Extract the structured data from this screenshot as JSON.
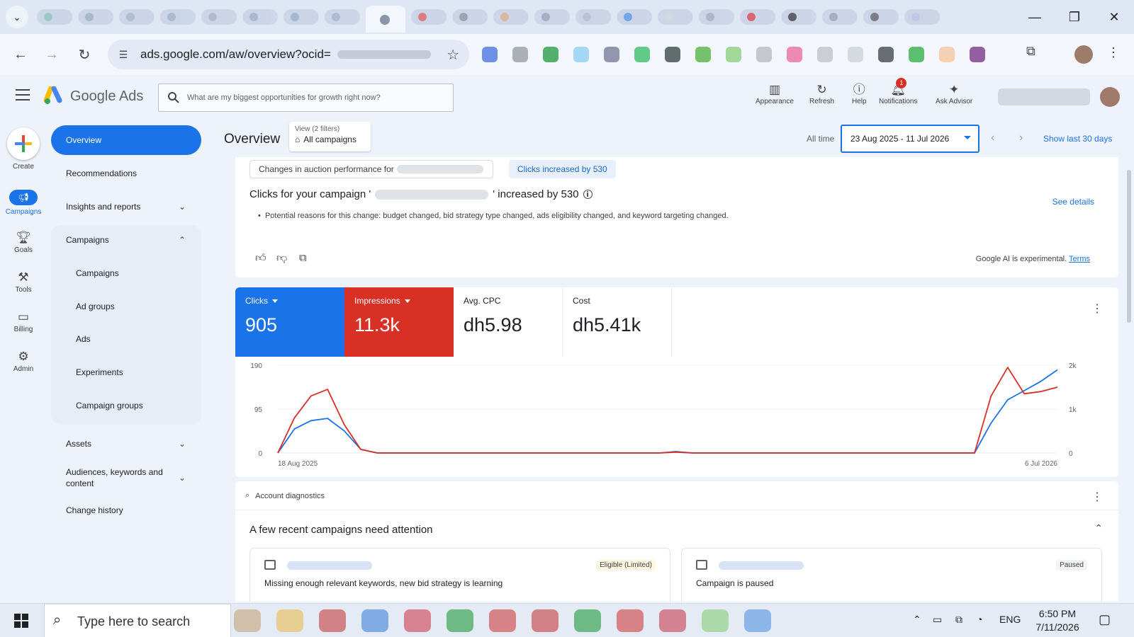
{
  "browser": {
    "url": "ads.google.com/aw/overview?ocid=",
    "tab_colors": [
      "#8fc4c0",
      "#9fb0c8",
      "#a8b6d0",
      "#a2b2cc",
      "#a6b4cd",
      "#a0b0ca",
      "#9cb0cc",
      "#a4b4ce"
    ],
    "tab_colors_right": [
      "#d96b6b",
      "#9099a8",
      "#d9b08c",
      "#9aa6bf",
      "#b3bfd3",
      "#5e9be0",
      "#d0d6e0",
      "#a3b0c8",
      "#d9515e",
      "#4a4a52",
      "#9aa6bf",
      "#6b6b75",
      "#b9c4e6"
    ],
    "extension_colors": [
      "#4a78e0",
      "#9aa0a6",
      "#2e9f48",
      "#8fd0f0",
      "#7a7f9a",
      "#3cbf6a",
      "#3c4a48",
      "#55b548",
      "#8cd080",
      "#b8bcc2",
      "#e86fa0",
      "#c0c4ca",
      "#cdd2d8",
      "#444a52",
      "#34b24a",
      "#f4c8a0",
      "#7a3a8a"
    ]
  },
  "header": {
    "brand": "Google Ads",
    "search_placeholder": "What are my biggest opportunities for growth right now?",
    "actions": [
      {
        "label": "Appearance",
        "icon": "appearance-icon"
      },
      {
        "label": "Refresh",
        "icon": "refresh-icon"
      },
      {
        "label": "Help",
        "icon": "help-icon"
      },
      {
        "label": "Notifications",
        "icon": "bell-icon",
        "badge": "1"
      },
      {
        "label": "Ask Advisor",
        "icon": "advisor-icon"
      }
    ]
  },
  "rail": {
    "create": "Create",
    "items": [
      {
        "label": "Campaigns",
        "icon": "megaphone-icon"
      },
      {
        "label": "Goals",
        "icon": "trophy-icon"
      },
      {
        "label": "Tools",
        "icon": "tools-icon"
      },
      {
        "label": "Billing",
        "icon": "credit-card-icon"
      },
      {
        "label": "Admin",
        "icon": "gear-icon"
      }
    ]
  },
  "nav": {
    "overview": "Overview",
    "recommendations": "Recommendations",
    "insights": "Insights and reports",
    "campaigns": "Campaigns",
    "sub": [
      "Campaigns",
      "Ad groups",
      "Ads",
      "Experiments",
      "Campaign groups"
    ],
    "assets": "Assets",
    "audiences": "Audiences, keywords and content",
    "change_history": "Change history"
  },
  "page": {
    "title": "Overview",
    "view_label": "View (2 filters)",
    "view_value": "All campaigns",
    "all_time": "All time",
    "date_range": "23 Aug 2025 - 11 Jul 2026",
    "show_last": "Show last 30 days"
  },
  "insight": {
    "chip_auction": "Changes in auction performance for",
    "chip_clicks": "Clicks increased by 530",
    "title_prefix": "Clicks for your campaign '",
    "title_suffix": "' increased by 530",
    "bullet": "Potential reasons for this change: budget changed, bid strategy type changed, ads eligibility changed, and keyword targeting changed.",
    "see_details": "See details",
    "ai_note": "Google AI is experimental.",
    "terms": "Terms"
  },
  "metrics": {
    "clicks_label": "Clicks",
    "clicks_value": "905",
    "impr_label": "Impressions",
    "impr_value": "11.3k",
    "cpc_label": "Avg. CPC",
    "cpc_value": "dh5.98",
    "cost_label": "Cost",
    "cost_value": "dh5.41k"
  },
  "chart_data": {
    "type": "line",
    "x_start_label": "18 Aug 2025",
    "x_end_label": "6 Jul 2026",
    "y_left_ticks": [
      "190",
      "95",
      "0"
    ],
    "y_right_ticks": [
      "2k",
      "1k",
      "0"
    ],
    "ylim_left": [
      0,
      190
    ],
    "ylim_right": [
      0,
      2000
    ],
    "colors": {
      "clicks": "#1a73e8",
      "impressions": "#d93025"
    },
    "series": [
      {
        "name": "Clicks",
        "axis": "left",
        "values": [
          0,
          52,
          70,
          75,
          48,
          8,
          0,
          0,
          0,
          0,
          0,
          0,
          0,
          0,
          0,
          0,
          0,
          0,
          0,
          0,
          0,
          0,
          0,
          0,
          3,
          0,
          0,
          0,
          0,
          0,
          0,
          0,
          0,
          0,
          0,
          0,
          0,
          0,
          0,
          0,
          0,
          0,
          0,
          65,
          115,
          135,
          155,
          180
        ]
      },
      {
        "name": "Impressions",
        "axis": "right",
        "values": [
          0,
          800,
          1300,
          1450,
          650,
          80,
          0,
          0,
          0,
          0,
          0,
          0,
          0,
          0,
          0,
          0,
          0,
          0,
          0,
          0,
          0,
          0,
          0,
          0,
          20,
          0,
          0,
          0,
          0,
          0,
          0,
          0,
          0,
          0,
          0,
          0,
          0,
          0,
          0,
          0,
          0,
          0,
          0,
          1300,
          1950,
          1350,
          1400,
          1500
        ]
      }
    ]
  },
  "diagnostics": {
    "header": "Account diagnostics",
    "title": "A few recent campaigns need attention",
    "cards": [
      {
        "status": "Eligible (Limited)",
        "message": "Missing enough relevant keywords, new bid strategy is learning"
      },
      {
        "status": "Paused",
        "message": "Campaign is paused"
      }
    ]
  },
  "taskbar": {
    "search_placeholder": "Type here to search",
    "app_colors": [
      "#c8a880",
      "#e8c060",
      "#c84a4a",
      "#4a8ad8",
      "#d04a5a",
      "#2e9f48",
      "#d04a4a",
      "#c84a4a",
      "#2e9f48",
      "#d04a4a",
      "#c84a5a",
      "#8cd080",
      "#5e9be0"
    ],
    "lang": "ENG",
    "time": "6:50 PM",
    "date": "7/11/2026"
  }
}
